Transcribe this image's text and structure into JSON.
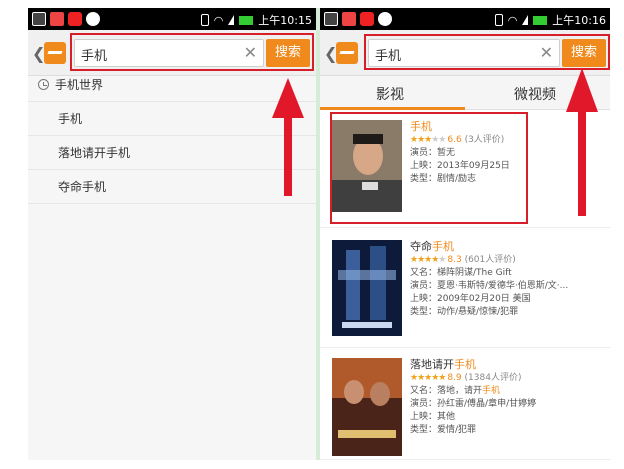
{
  "status_bar": {
    "time_left": "上午10:15",
    "time_right": "上午10:16"
  },
  "left": {
    "search_value": "手机",
    "search_button": "搜索",
    "back": "❮",
    "clear": "✕",
    "suggestions": [
      "手机世界",
      "手机",
      "落地请开手机",
      "夺命手机"
    ]
  },
  "right": {
    "search_value": "手机",
    "search_button": "搜索",
    "back": "❮",
    "clear": "✕",
    "tabs": [
      "影视",
      "微视频"
    ],
    "movies": [
      {
        "title_pre": "",
        "title_hl": "手机",
        "rating": "6.6",
        "reviews": "(3人评价)",
        "lines": [
          "演员：暂无",
          "上映：2013年09月25日",
          "类型：剧情/励志"
        ]
      },
      {
        "title_pre": "夺命",
        "title_hl": "手机",
        "rating": "8.3",
        "reviews": "(601人评价)",
        "lines": [
          "又名：梯阵阴谋/The Gift",
          "演员：夏恩·韦斯特/爱德华·伯恩斯/文·...",
          "上映：2009年02月20日 美国",
          "类型：动作/悬疑/惊悚/犯罪"
        ]
      },
      {
        "title_pre": "落地请开",
        "title_hl": "手机",
        "rating": "8.9",
        "reviews": "(1384人评价)",
        "aka_pre": "又名：落地，请开",
        "aka_hl": "手机",
        "lines": [
          "演员：孙红雷/傅晶/章申/甘婷婷",
          "上映：其他",
          "类型：爱情/犯罪"
        ]
      }
    ]
  },
  "colors": {
    "accent": "#f08a1c",
    "highlight_frame": "#d81e28",
    "arrow": "#e0182a"
  }
}
